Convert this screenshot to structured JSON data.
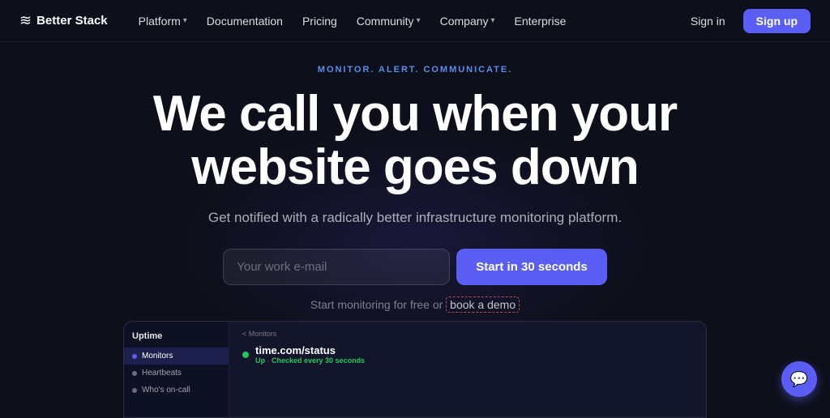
{
  "nav": {
    "logo_icon": "≋",
    "logo_text": "Better Stack",
    "links": [
      {
        "label": "Platform",
        "has_dropdown": true
      },
      {
        "label": "Documentation",
        "has_dropdown": false
      },
      {
        "label": "Pricing",
        "has_dropdown": false
      },
      {
        "label": "Community",
        "has_dropdown": true
      },
      {
        "label": "Company",
        "has_dropdown": true
      },
      {
        "label": "Enterprise",
        "has_dropdown": false
      }
    ],
    "signin_label": "Sign in",
    "signup_label": "Sign up"
  },
  "hero": {
    "tagline": "MONITOR. ALERT. COMMUNICATE.",
    "title_line1": "We call you when your",
    "title_line2": "website goes down",
    "subtitle": "Get notified with a radically better infrastructure monitoring platform.",
    "input_placeholder": "Your work e-mail",
    "cta_label": "Start in 30 seconds",
    "demo_text_before": "Start monitoring for free or",
    "demo_link_label": "book a demo"
  },
  "dashboard": {
    "sidebar": {
      "section_title": "Uptime",
      "items": [
        {
          "label": "Monitors",
          "active": true
        },
        {
          "label": "Heartbeats",
          "active": false
        },
        {
          "label": "Who's on-call",
          "active": false
        }
      ]
    },
    "breadcrumb": "< Monitors",
    "monitor_name": "time.com/status",
    "monitor_status": "Up",
    "monitor_detail": "Checked every 30 seconds"
  },
  "chat": {
    "icon": "💬"
  },
  "colors": {
    "accent": "#5b5ef4",
    "bg": "#0d0f1a",
    "green": "#22c55e"
  }
}
